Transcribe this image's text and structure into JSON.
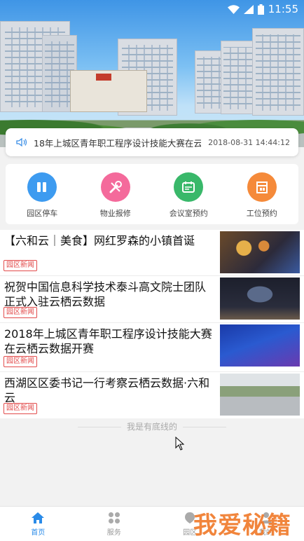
{
  "status_bar": {
    "time": "11:55"
  },
  "ticker": {
    "headline": "18年上城区青年职工程序设计技能大赛在云栖云",
    "date": "2018-08-31 14:44:12"
  },
  "quick_services": [
    {
      "label": "园区停车",
      "icon": "parking-icon",
      "color": "#3d9bf0"
    },
    {
      "label": "物业报修",
      "icon": "repair-icon",
      "color": "#f46a9b"
    },
    {
      "label": "会议室预约",
      "icon": "meeting-room-icon",
      "color": "#39b86a"
    },
    {
      "label": "工位预约",
      "icon": "workstation-icon",
      "color": "#f58a3a"
    }
  ],
  "news": [
    {
      "title": "【六和云｜美食】网红罗森的小镇首诞",
      "tag": "园区新闻"
    },
    {
      "title": "祝贺中国信息科学技术泰斗高文院士团队正式入驻云栖云数据",
      "tag": "园区新闻"
    },
    {
      "title": "2018年上城区青年职工程序设计技能大赛在云栖云数据开赛",
      "tag": "园区新闻"
    },
    {
      "title": "西湖区区委书记一行考察云栖云数据·六和云",
      "tag": "园区新闻"
    }
  ],
  "list_footer": "我是有底线的",
  "tabs": [
    {
      "label": "首页",
      "icon": "home-icon",
      "active": true
    },
    {
      "label": "服务",
      "icon": "grid-icon",
      "active": false
    },
    {
      "label": "园区",
      "icon": "park-icon",
      "active": false
    },
    {
      "label": "我的",
      "icon": "user-icon",
      "active": false
    }
  ],
  "watermark": "我爱秘籍",
  "colors": {
    "accent": "#2a8be8",
    "tag_red": "#e24b4b"
  }
}
